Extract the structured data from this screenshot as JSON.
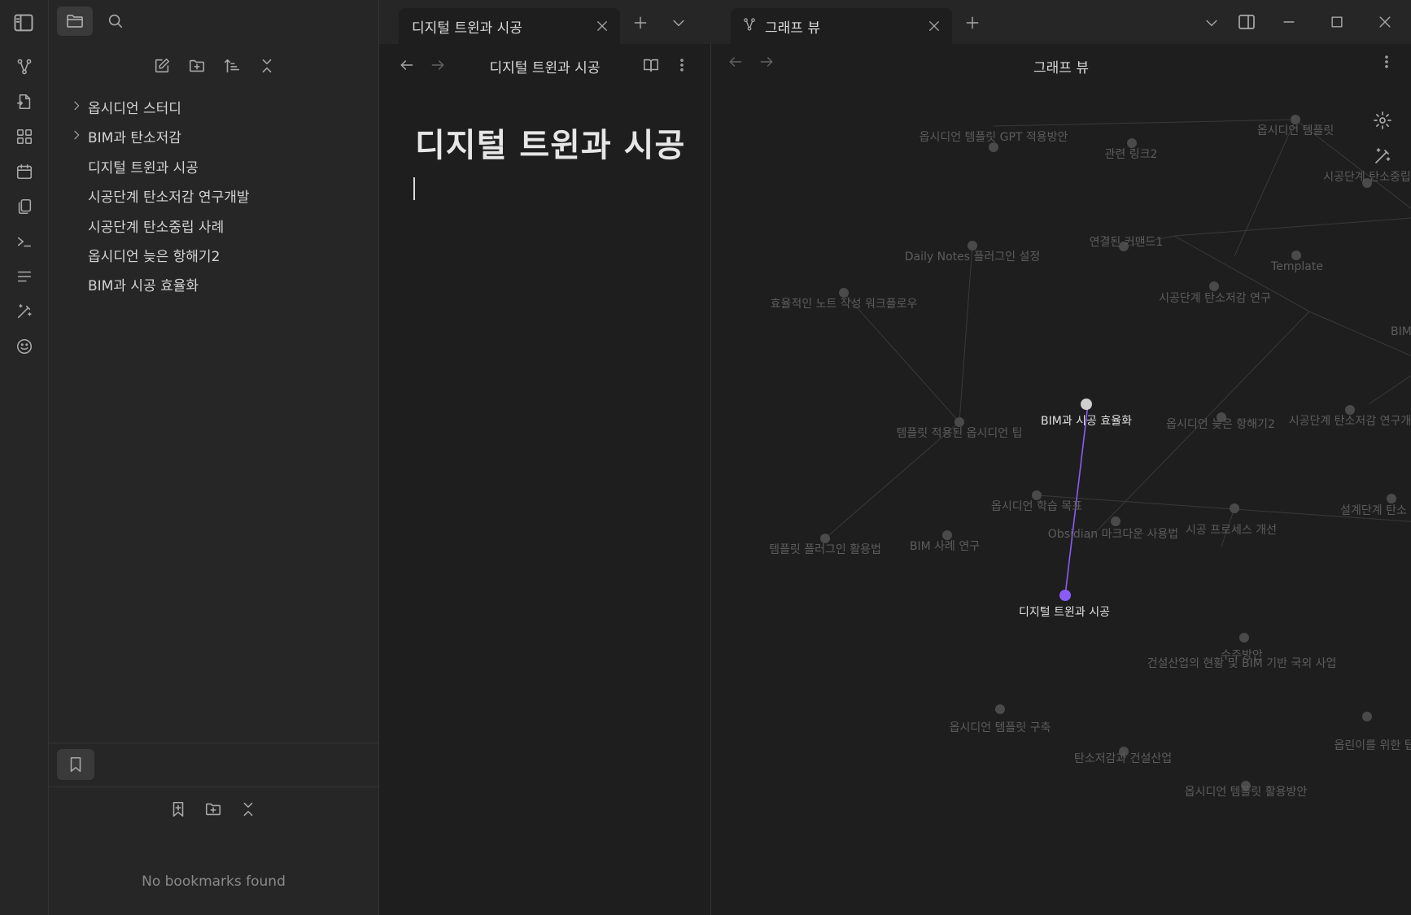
{
  "ribbon": {
    "icons": [
      "sidebar-toggle-icon",
      "graph-icon",
      "file-switch-icon",
      "blocks-icon",
      "calendar-icon",
      "copy-icon",
      "terminal-icon",
      "list-icon",
      "magic-wand-icon",
      "emoji-icon"
    ]
  },
  "sidebar": {
    "tabs": [
      "folder-icon",
      "search-icon"
    ],
    "nav_actions": [
      "new-note-icon",
      "new-folder-icon",
      "sort-icon",
      "collapse-all-icon"
    ],
    "tree": [
      {
        "label": "옵시디언 스터디",
        "folder": true
      },
      {
        "label": "BIM과 탄소저감",
        "folder": true
      },
      {
        "label": "디지털 트윈과 시공",
        "folder": false
      },
      {
        "label": "시공단계 탄소저감 연구개발",
        "folder": false
      },
      {
        "label": "시공단계 탄소중립 사례",
        "folder": false
      },
      {
        "label": "옵시디언 늦은 항해기2",
        "folder": false
      },
      {
        "label": "BIM과 시공 효율화",
        "folder": false
      }
    ],
    "bookmarks": {
      "tab_icon": "bookmark-icon",
      "actions": [
        "bookmark-add-icon",
        "new-group-icon",
        "collapse-icon"
      ],
      "empty_text": "No bookmarks found"
    }
  },
  "tabs": [
    {
      "label": "디지털 트윈과 시공",
      "icon": null
    },
    {
      "label": "그래프 뷰",
      "icon": "graph-icon"
    }
  ],
  "editor": {
    "view_title": "디지털 트윈과 시공",
    "heading": "디지털 트윈과 시공"
  },
  "graph": {
    "view_title": "그래프 뷰",
    "accent": "#8a5cf5",
    "nodes": [
      {
        "id": "n1",
        "label": "옵시디언 템플릿 GPT 적용방안"
      },
      {
        "id": "n2",
        "label": "관련 링크2"
      },
      {
        "id": "n3",
        "label": "옵시디언 템플릿"
      },
      {
        "id": "n4",
        "label": "시공단계 탄소중립"
      },
      {
        "id": "n5",
        "label": "연결된 커맨드1"
      },
      {
        "id": "n6",
        "label": "Daily Notes 플러그인 설정"
      },
      {
        "id": "n7",
        "label": "Template"
      },
      {
        "id": "n8",
        "label": "시공단계 탄소저감 연구"
      },
      {
        "id": "n9",
        "label": "효율적인 노트 작성 워크플로우"
      },
      {
        "id": "n10",
        "label": "BIM"
      },
      {
        "id": "n11",
        "label": "BIM과 시공 효율화"
      },
      {
        "id": "n12",
        "label": "템플릿 적용된 옵시디언 팁"
      },
      {
        "id": "n13",
        "label": "옵시디언 늦은 항해기2"
      },
      {
        "id": "n14",
        "label": "시공단계 탄소저감 연구개"
      },
      {
        "id": "n15",
        "label": "옵시디언 학습 목표"
      },
      {
        "id": "n16",
        "label": "설계단계 탄소"
      },
      {
        "id": "n17",
        "label": "템플릿 플러그인 활용법"
      },
      {
        "id": "n18",
        "label": "BIM 사례 연구"
      },
      {
        "id": "n19",
        "label": "Obsidian 마크다운 사용법"
      },
      {
        "id": "n20",
        "label": "시공 프로세스 개선"
      },
      {
        "id": "n21",
        "label": "디지털 트윈과 시공"
      },
      {
        "id": "n22",
        "label": "건설산업의 현황 및 BIM 기반 국외 사업"
      },
      {
        "id": "n22b",
        "label": "수주방안"
      },
      {
        "id": "n23",
        "label": "옵시디언 템플릿 구축"
      },
      {
        "id": "n24",
        "label": "옵린이를 위한 팁"
      },
      {
        "id": "n25",
        "label": "탄소저감과 건설산업"
      },
      {
        "id": "n26",
        "label": "옵시디언 템플릿 활용방안"
      }
    ]
  }
}
